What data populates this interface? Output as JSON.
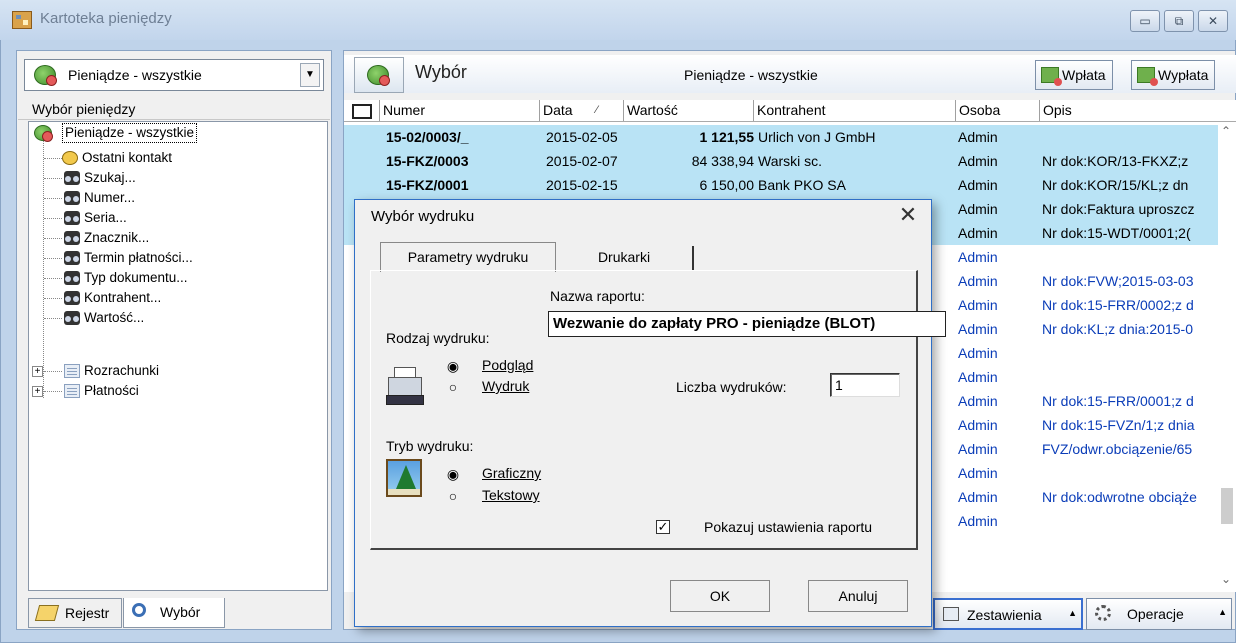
{
  "window": {
    "title": "Kartoteka pieniędzy",
    "caption_buttons": {
      "minimize": "▭",
      "restore": "⧉",
      "close": "✕"
    }
  },
  "left_panel": {
    "combo_value": "Pieniądze - wszystkie",
    "header": "Wybór pieniędzy",
    "tree": {
      "root": "Pieniądze - wszystkie",
      "items": [
        "Ostatni kontakt",
        "Szukaj...",
        "Numer...",
        "Seria...",
        "Znacznik...",
        "Termin płatności...",
        "Typ dokumentu...",
        "Kontrahent...",
        "Wartość..."
      ],
      "groups": [
        "Rozrachunki",
        "Płatności"
      ]
    },
    "tabs": {
      "rejestr": "Rejestr",
      "wybor": "Wybór"
    }
  },
  "right_panel": {
    "toolbar_label": "Wybór",
    "toolbar_title": "Pieniądze - wszystkie",
    "wplata": "Wpłata",
    "wyplata": "Wypłata",
    "columns": [
      "Numer",
      "Data",
      "Wartość",
      "Kontrahent",
      "Osoba",
      "Opis"
    ],
    "rows": [
      {
        "numer": "15-02/0003/_",
        "data": "2015-02-05",
        "wartosc": "1 121,55",
        "kontrahent": "Urlich von J GmbH",
        "osoba": "Admin",
        "opis": "",
        "selected": true,
        "bold_value": true
      },
      {
        "numer": "15-FKZ/0003",
        "data": "2015-02-07",
        "wartosc": "84 338,94",
        "kontrahent": "Warski sc.",
        "osoba": "Admin",
        "opis": "Nr dok:KOR/13-FKXZ;z",
        "selected": true,
        "bold_value": false
      },
      {
        "numer": "15-FKZ/0001",
        "data": "2015-02-15",
        "wartosc": "6 150,00",
        "kontrahent": "Bank PKO SA",
        "osoba": "Admin",
        "opis": "Nr dok:KOR/15/KL;z dn",
        "selected": true,
        "bold_value": false
      },
      {
        "numer": "",
        "data": "",
        "wartosc": "",
        "kontrahent": "",
        "osoba": "Admin",
        "opis": "Nr dok:Faktura uproszcz",
        "selected": true,
        "bold_value": false
      },
      {
        "numer": "",
        "data": "",
        "wartosc": "",
        "kontrahent": "",
        "osoba": "Admin",
        "opis": "Nr dok:15-WDT/0001;2(",
        "selected": true,
        "bold_value": false
      },
      {
        "numer": "",
        "data": "",
        "wartosc": "",
        "kontrahent": "",
        "osoba": "Admin",
        "opis": "",
        "selected": false,
        "bold_value": false
      },
      {
        "numer": "",
        "data": "",
        "wartosc": "",
        "kontrahent": "",
        "osoba": "Admin",
        "opis": "Nr dok:FVW;2015-03-03",
        "selected": false,
        "bold_value": false
      },
      {
        "numer": "",
        "data": "",
        "wartosc": "",
        "kontrahent": "",
        "osoba": "Admin",
        "opis": "Nr dok:15-FRR/0002;z d",
        "selected": false,
        "bold_value": false
      },
      {
        "numer": "",
        "data": "",
        "wartosc": "",
        "kontrahent": "",
        "osoba": "Admin",
        "opis": "Nr dok:KL;z dnia:2015-0",
        "selected": false,
        "bold_value": false
      },
      {
        "numer": "",
        "data": "",
        "wartosc": "",
        "kontrahent": "",
        "osoba": "Admin",
        "opis": "",
        "selected": false,
        "bold_value": false
      },
      {
        "numer": "",
        "data": "",
        "wartosc": "",
        "kontrahent": "",
        "osoba": "Admin",
        "opis": "",
        "selected": false,
        "bold_value": false
      },
      {
        "numer": "",
        "data": "",
        "wartosc": "",
        "kontrahent": "",
        "osoba": "Admin",
        "opis": "Nr dok:15-FRR/0001;z d",
        "selected": false,
        "bold_value": false
      },
      {
        "numer": "",
        "data": "",
        "wartosc": "",
        "kontrahent": "",
        "osoba": "Admin",
        "opis": "Nr dok:15-FVZn/1;z dnia",
        "selected": false,
        "bold_value": false
      },
      {
        "numer": "",
        "data": "",
        "wartosc": "",
        "kontrahent": "",
        "osoba": "Admin",
        "opis": "FVZ/odwr.obciązenie/65",
        "selected": false,
        "bold_value": false
      },
      {
        "numer": "",
        "data": "",
        "wartosc": "",
        "kontrahent": "",
        "osoba": "Admin",
        "opis": "",
        "selected": false,
        "bold_value": false
      },
      {
        "numer": "",
        "data": "",
        "wartosc": "",
        "kontrahent": "",
        "osoba": "Admin",
        "opis": "Nr dok:odwrotne obciąże",
        "selected": false,
        "bold_value": false
      },
      {
        "numer": "",
        "data": "",
        "wartosc": "",
        "kontrahent": "",
        "osoba": "Admin",
        "opis": "",
        "selected": false,
        "bold_value": false
      }
    ],
    "zestawienia": "Zestawienia",
    "operacje": "Operacje"
  },
  "dialog": {
    "title": "Wybór wydruku",
    "tab_params": "Parametry wydruku",
    "tab_printers": "Drukarki",
    "report_name_label": "Nazwa raportu:",
    "report_name": "Wezwanie do zapłaty PRO - pieniądze (BLOT)",
    "print_type_label": "Rodzaj wydruku:",
    "opt_preview": "Podgląd",
    "opt_print": "Wydruk",
    "copies_label": "Liczba wydruków:",
    "copies_value": "1",
    "mode_label": "Tryb wydruku:",
    "opt_graphic": "Graficzny",
    "opt_text": "Tekstowy",
    "show_settings": "Pokazuj ustawienia raportu",
    "ok": "OK",
    "cancel": "Anuluj"
  },
  "colors": {
    "selected_row": "#b9e3f5",
    "link_blue": "#0b3db8",
    "dialog_border": "#2f6fc7"
  }
}
